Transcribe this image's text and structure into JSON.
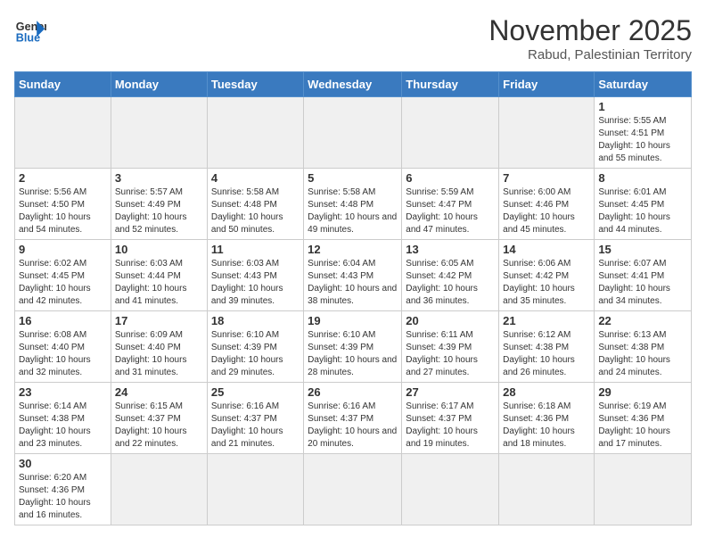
{
  "logo": {
    "text_general": "General",
    "text_blue": "Blue"
  },
  "header": {
    "title": "November 2025",
    "subtitle": "Rabud, Palestinian Territory"
  },
  "weekdays": [
    "Sunday",
    "Monday",
    "Tuesday",
    "Wednesday",
    "Thursday",
    "Friday",
    "Saturday"
  ],
  "days": [
    {
      "num": "",
      "info": ""
    },
    {
      "num": "",
      "info": ""
    },
    {
      "num": "",
      "info": ""
    },
    {
      "num": "",
      "info": ""
    },
    {
      "num": "",
      "info": ""
    },
    {
      "num": "",
      "info": ""
    },
    {
      "num": "1",
      "info": "Sunrise: 5:55 AM\nSunset: 4:51 PM\nDaylight: 10 hours\nand 55 minutes."
    },
    {
      "num": "2",
      "info": "Sunrise: 5:56 AM\nSunset: 4:50 PM\nDaylight: 10 hours\nand 54 minutes."
    },
    {
      "num": "3",
      "info": "Sunrise: 5:57 AM\nSunset: 4:49 PM\nDaylight: 10 hours\nand 52 minutes."
    },
    {
      "num": "4",
      "info": "Sunrise: 5:58 AM\nSunset: 4:48 PM\nDaylight: 10 hours\nand 50 minutes."
    },
    {
      "num": "5",
      "info": "Sunrise: 5:58 AM\nSunset: 4:48 PM\nDaylight: 10 hours\nand 49 minutes."
    },
    {
      "num": "6",
      "info": "Sunrise: 5:59 AM\nSunset: 4:47 PM\nDaylight: 10 hours\nand 47 minutes."
    },
    {
      "num": "7",
      "info": "Sunrise: 6:00 AM\nSunset: 4:46 PM\nDaylight: 10 hours\nand 45 minutes."
    },
    {
      "num": "8",
      "info": "Sunrise: 6:01 AM\nSunset: 4:45 PM\nDaylight: 10 hours\nand 44 minutes."
    },
    {
      "num": "9",
      "info": "Sunrise: 6:02 AM\nSunset: 4:45 PM\nDaylight: 10 hours\nand 42 minutes."
    },
    {
      "num": "10",
      "info": "Sunrise: 6:03 AM\nSunset: 4:44 PM\nDaylight: 10 hours\nand 41 minutes."
    },
    {
      "num": "11",
      "info": "Sunrise: 6:03 AM\nSunset: 4:43 PM\nDaylight: 10 hours\nand 39 minutes."
    },
    {
      "num": "12",
      "info": "Sunrise: 6:04 AM\nSunset: 4:43 PM\nDaylight: 10 hours\nand 38 minutes."
    },
    {
      "num": "13",
      "info": "Sunrise: 6:05 AM\nSunset: 4:42 PM\nDaylight: 10 hours\nand 36 minutes."
    },
    {
      "num": "14",
      "info": "Sunrise: 6:06 AM\nSunset: 4:42 PM\nDaylight: 10 hours\nand 35 minutes."
    },
    {
      "num": "15",
      "info": "Sunrise: 6:07 AM\nSunset: 4:41 PM\nDaylight: 10 hours\nand 34 minutes."
    },
    {
      "num": "16",
      "info": "Sunrise: 6:08 AM\nSunset: 4:40 PM\nDaylight: 10 hours\nand 32 minutes."
    },
    {
      "num": "17",
      "info": "Sunrise: 6:09 AM\nSunset: 4:40 PM\nDaylight: 10 hours\nand 31 minutes."
    },
    {
      "num": "18",
      "info": "Sunrise: 6:10 AM\nSunset: 4:39 PM\nDaylight: 10 hours\nand 29 minutes."
    },
    {
      "num": "19",
      "info": "Sunrise: 6:10 AM\nSunset: 4:39 PM\nDaylight: 10 hours\nand 28 minutes."
    },
    {
      "num": "20",
      "info": "Sunrise: 6:11 AM\nSunset: 4:39 PM\nDaylight: 10 hours\nand 27 minutes."
    },
    {
      "num": "21",
      "info": "Sunrise: 6:12 AM\nSunset: 4:38 PM\nDaylight: 10 hours\nand 26 minutes."
    },
    {
      "num": "22",
      "info": "Sunrise: 6:13 AM\nSunset: 4:38 PM\nDaylight: 10 hours\nand 24 minutes."
    },
    {
      "num": "23",
      "info": "Sunrise: 6:14 AM\nSunset: 4:38 PM\nDaylight: 10 hours\nand 23 minutes."
    },
    {
      "num": "24",
      "info": "Sunrise: 6:15 AM\nSunset: 4:37 PM\nDaylight: 10 hours\nand 22 minutes."
    },
    {
      "num": "25",
      "info": "Sunrise: 6:16 AM\nSunset: 4:37 PM\nDaylight: 10 hours\nand 21 minutes."
    },
    {
      "num": "26",
      "info": "Sunrise: 6:16 AM\nSunset: 4:37 PM\nDaylight: 10 hours\nand 20 minutes."
    },
    {
      "num": "27",
      "info": "Sunrise: 6:17 AM\nSunset: 4:37 PM\nDaylight: 10 hours\nand 19 minutes."
    },
    {
      "num": "28",
      "info": "Sunrise: 6:18 AM\nSunset: 4:36 PM\nDaylight: 10 hours\nand 18 minutes."
    },
    {
      "num": "29",
      "info": "Sunrise: 6:19 AM\nSunset: 4:36 PM\nDaylight: 10 hours\nand 17 minutes."
    },
    {
      "num": "30",
      "info": "Sunrise: 6:20 AM\nSunset: 4:36 PM\nDaylight: 10 hours\nand 16 minutes."
    }
  ]
}
